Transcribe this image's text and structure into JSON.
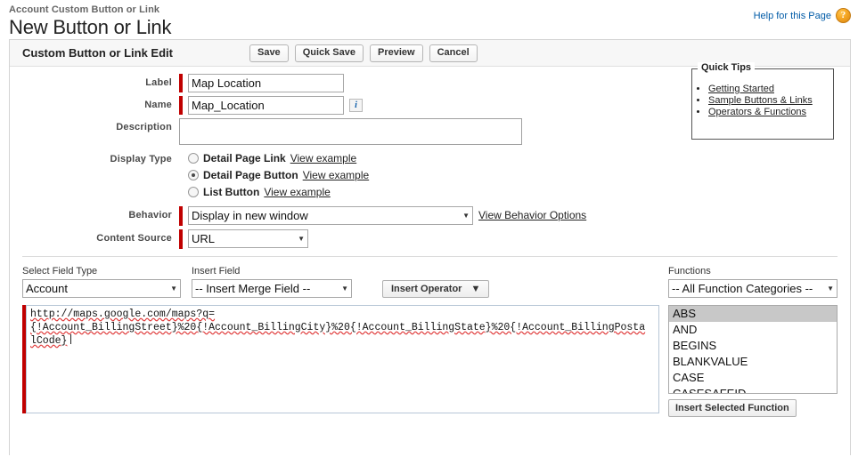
{
  "header": {
    "breadcrumb": "Account Custom Button or Link",
    "title": "New Button or Link",
    "help_label": "Help for this Page",
    "help_icon": "question-mark-icon",
    "help_icon_glyph": "?"
  },
  "panel": {
    "title": "Custom Button or Link Edit",
    "buttons": [
      {
        "label": "Save"
      },
      {
        "label": "Quick Save"
      },
      {
        "label": "Preview"
      },
      {
        "label": "Cancel"
      }
    ]
  },
  "form": {
    "label_field": {
      "label": "Label",
      "value": "Map Location",
      "required": true
    },
    "name_field": {
      "label": "Name",
      "value": "Map_Location",
      "required": true,
      "info_icon": "info-icon",
      "info_glyph": "i"
    },
    "description_field": {
      "label": "Description",
      "value": "",
      "placeholder": ""
    },
    "display_type": {
      "label": "Display Type",
      "options": [
        {
          "label": "Detail Page Link",
          "link": "View example",
          "selected": false
        },
        {
          "label": "Detail Page Button",
          "link": "View example",
          "selected": true
        },
        {
          "label": "List Button",
          "link": "View example",
          "selected": false
        }
      ]
    },
    "behavior": {
      "label": "Behavior",
      "value": "Display in new window",
      "required": true,
      "side_link": "View Behavior Options"
    },
    "content_source": {
      "label": "Content Source",
      "value": "URL",
      "required": true
    }
  },
  "quick_tips": {
    "legend": "Quick Tips",
    "links": [
      "Getting Started",
      "Sample Buttons & Links",
      "Operators & Functions"
    ]
  },
  "editor": {
    "field_type": {
      "label": "Select Field Type",
      "value": "Account"
    },
    "insert_field": {
      "label": "Insert Field",
      "value": "-- Insert Merge Field --"
    },
    "insert_operator": {
      "label": "Insert Operator"
    },
    "functions": {
      "label": "Functions",
      "value": "-- All Function Categories --"
    },
    "formula": {
      "line1": "http://maps.google.com/maps?q=",
      "line2": "{!Account_BillingStreet}%20{!Account_BillingCity}%20{!Account_BillingState}%20{!Account_BillingPosta",
      "line3": "lCode}"
    },
    "function_list": [
      {
        "name": "ABS",
        "selected": true
      },
      {
        "name": "AND",
        "selected": false
      },
      {
        "name": "BEGINS",
        "selected": false
      },
      {
        "name": "BLANKVALUE",
        "selected": false
      },
      {
        "name": "CASE",
        "selected": false
      },
      {
        "name": "CASESAFEID",
        "selected": false
      }
    ],
    "insert_selected_function": "Insert Selected Function"
  },
  "colors": {
    "required_marker": "#c00000",
    "link": "#015ba7",
    "help_icon": "#f5a623",
    "selection": "#c8c8c8"
  }
}
